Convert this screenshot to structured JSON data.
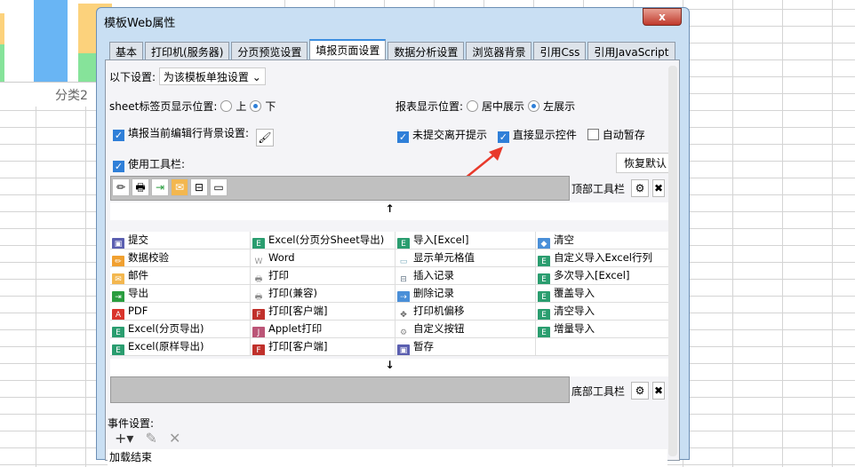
{
  "background": {
    "category_label": "分类2"
  },
  "dialog": {
    "title": "模板Web属性",
    "close": "x"
  },
  "tabs": [
    "基本",
    "打印机(服务器)",
    "分页预览设置",
    "填报页面设置",
    "数据分析设置",
    "浏览器背景",
    "引用Css",
    "引用JavaScript"
  ],
  "settings": {
    "scope_label": "以下设置:",
    "scope_value": "为该模板单独设置",
    "sheet_pos_label": "sheet标签页显示位置:",
    "sheet_up": "上",
    "sheet_down": "下",
    "report_pos_label": "报表显示位置:",
    "center": "居中展示",
    "left": "左展示",
    "edit_row_bg": "填报当前编辑行背景设置:",
    "unsubmitted": "未提交离开提示",
    "show_controls": "直接显示控件",
    "auto_save": "自动暂存",
    "use_toolbar": "使用工具栏:",
    "restore": "恢复默认"
  },
  "toolbar": {
    "top_label": "顶部工具栏",
    "bottom_label": "底部工具栏",
    "up_arrow": "↑",
    "down_arrow": "↓"
  },
  "buttons": [
    [
      "提交",
      "Excel(分页分Sheet导出)",
      "导入[Excel]",
      "清空"
    ],
    [
      "数据校验",
      "Word",
      "显示单元格值",
      "自定义导入Excel行列"
    ],
    [
      "邮件",
      "打印",
      "插入记录",
      "多次导入[Excel]"
    ],
    [
      "导出",
      "打印(兼容)",
      "删除记录",
      "覆盖导入"
    ],
    [
      "PDF",
      "打印[客户端]",
      "打印机偏移",
      "清空导入"
    ],
    [
      "Excel(分页导出)",
      "Applet打印",
      "自定义按钮",
      "增量导入"
    ],
    [
      "Excel(原样导出)",
      "打印[客户端]",
      "暂存",
      ""
    ]
  ],
  "events": {
    "label": "事件设置:",
    "items": [
      "加载结束"
    ]
  },
  "colors": {
    "accent": "#2f7fd8",
    "excel": "#2a9d6f",
    "pdf": "#d9342b"
  }
}
